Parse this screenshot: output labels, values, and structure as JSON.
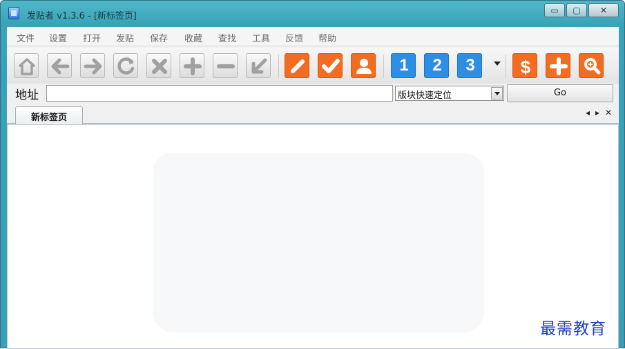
{
  "window": {
    "title": "发贴者 v1.3.6 - [新标签页]",
    "controls": {
      "minimize": "▭",
      "maximize": "▢",
      "close": "✕"
    }
  },
  "menu": [
    "文件",
    "设置",
    "打开",
    "发贴",
    "保存",
    "收藏",
    "查找",
    "工具",
    "反馈",
    "帮助"
  ],
  "toolbar": {
    "nav_icons": [
      "home-icon",
      "back-arrow-icon",
      "forward-arrow-icon",
      "refresh-icon",
      "stop-icon",
      "zoom-in-plus-icon",
      "zoom-out-minus-icon",
      "collapse-arrow-icon"
    ],
    "action_icons": [
      "pencil-icon",
      "checkmark-icon",
      "user-icon"
    ],
    "account_numbers": [
      "1",
      "2",
      "3"
    ],
    "extra_icons": [
      "dollar-icon",
      "plus-icon",
      "search-icon"
    ],
    "colors": {
      "orange": "#f26d21",
      "blue": "#2d8ee6",
      "gray": "#9a9a9a"
    }
  },
  "address": {
    "label": "地址",
    "value": "",
    "select_value": "版块快速定位",
    "go_label": "Go"
  },
  "tabs": [
    {
      "label": "新标签页"
    }
  ],
  "tab_controls": {
    "prev": "◂",
    "next": "▸",
    "close": "✕"
  },
  "watermark": "最需教育"
}
